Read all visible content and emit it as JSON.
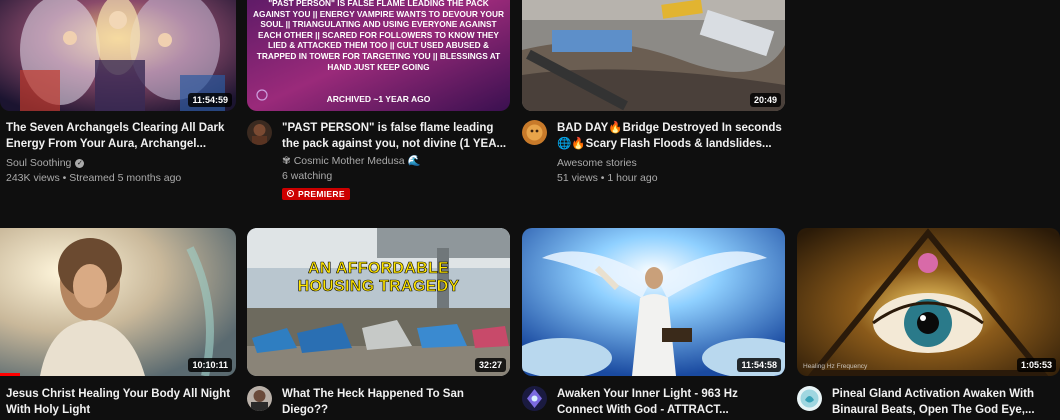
{
  "videos": [
    {
      "title": "The Seven Archangels Clearing All Dark Energy From Your Aura, Archangel...",
      "channel": "Soul Soothing",
      "verified": true,
      "stats": "243K views • Streamed 5 months ago",
      "duration": "11:54:59"
    },
    {
      "title": "\"PAST PERSON\" is false flame leading the pack against you, not divine (1 YEA...",
      "channel": "✾ Cosmic Mother Medusa 🌊",
      "stats": "6 watching",
      "badge": "PREMIERE",
      "thumb_text": "\"PAST PERSON\" IS FALSE FLAME LEADING THE PACK AGAINST YOU || ENERGY VAMPIRE WANTS TO DEVOUR YOUR SOUL || TRIANGULATING AND USING EVERYONE AGAINST EACH OTHER || SCARED FOR FOLLOWERS TO KNOW THEY LIED & ATTACKED THEM TOO || CULT USED ABUSED & TRAPPED IN TOWER FOR TARGETING YOU || BLESSINGS AT HAND JUST KEEP GOING",
      "thumb_footer": "ARCHIVED ~1 YEAR AGO"
    },
    {
      "title": "BAD DAY🔥Bridge Destroyed In seconds 🌐🔥Scary Flash Floods & landslides...",
      "channel": "Awesome stories",
      "stats": "51 views • 1 hour ago",
      "duration": "20:49"
    },
    {
      "title": "Jesus Christ Healing Your Body All Night With Holy Light",
      "duration": "10:10:11",
      "progress": 0.12
    },
    {
      "title": "What The Heck Happened To San Diego??",
      "duration": "32:27",
      "thumb_line1": "AN AFFORDABLE",
      "thumb_line2": "HOUSING TRAGEDY"
    },
    {
      "title": "Awaken Your Inner Light - 963 Hz Connect With God - ATTRACT...",
      "duration": "11:54:58"
    },
    {
      "title": "Pineal Gland Activation Awaken With Binaural Beats, Open The God Eye,...",
      "duration": "1:05:53",
      "thumb_caption": "Healing Hz Frequency"
    }
  ],
  "colors": {
    "background": "#0f0f0f",
    "title": "#f1f1f1",
    "secondary": "#aaaaaa",
    "premiere_badge": "#cc0000",
    "progress": "#ff0000"
  }
}
